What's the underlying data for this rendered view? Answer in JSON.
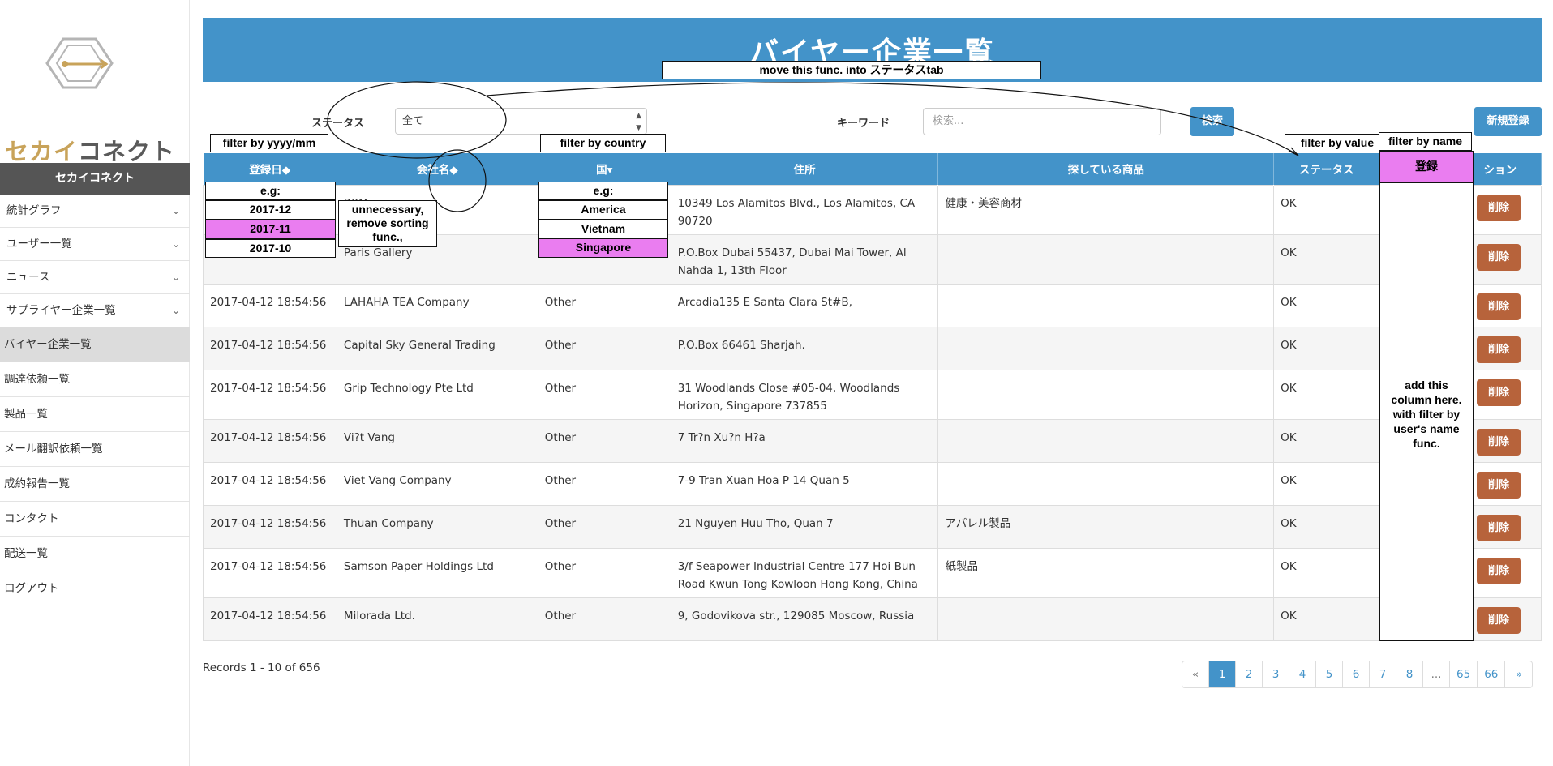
{
  "sidebar": {
    "logo_text_a": "セカイ",
    "logo_text_b": "コネクト",
    "header": "セカイコネクト",
    "items": [
      {
        "label": "統計グラフ",
        "chevron": "chevron-down-icon"
      },
      {
        "label": "ユーザー一覧",
        "chevron": "chevron-down-icon"
      },
      {
        "label": "ニュース",
        "chevron": "chevron-down-icon"
      },
      {
        "label": "サプライヤー企業一覧",
        "chevron": "chevron-down-icon"
      },
      {
        "label": "バイヤー企業一覧",
        "active": true
      },
      {
        "label": "調達依頼一覧"
      },
      {
        "label": "製品一覧"
      },
      {
        "label": "メール翻訳依頼一覧"
      },
      {
        "label": "成約報告一覧"
      },
      {
        "label": "コンタクト"
      },
      {
        "label": "配送一覧"
      },
      {
        "label": "ログアウト"
      }
    ]
  },
  "page": {
    "title": "バイヤー企業一覧"
  },
  "filters": {
    "status_label": "ステータス",
    "status_value": "全て",
    "keyword_label": "キーワード",
    "keyword_placeholder": "検索...",
    "search_button": "検索",
    "new_button": "新規登録"
  },
  "table": {
    "headers": [
      "登録日",
      "会社名",
      "国",
      "住所",
      "探している商品",
      "ステータス",
      "アクション"
    ],
    "header_display": {
      "date": "登録日◆",
      "company": "会社名◆",
      "country": "国▾",
      "address": "住所",
      "products": "探している商品",
      "status": "ステータス",
      "action": "ション"
    },
    "rows": [
      {
        "date": "",
        "company": "RKM",
        "country": "",
        "address": "10349 Los Alamitos Blvd., Los Alamitos, CA 90720",
        "products": "健康・美容商材",
        "status": "OK",
        "action": "削除"
      },
      {
        "date": "",
        "company": "Paris Gallery",
        "country": "",
        "address": "P.O.Box Dubai 55437, Dubai Mai Tower, Al Nahda 1, 13th Floor",
        "products": "",
        "status": "OK",
        "action": "削除"
      },
      {
        "date": "2017-04-12 18:54:56",
        "company": "LAHAHA TEA Company",
        "country": "Other",
        "address": "Arcadia135 E Santa Clara St#B,",
        "products": "",
        "status": "OK",
        "action": "削除"
      },
      {
        "date": "2017-04-12 18:54:56",
        "company": "Capital Sky General Trading",
        "country": "Other",
        "address": "P.O.Box 66461 Sharjah.",
        "products": "",
        "status": "OK",
        "action": "削除"
      },
      {
        "date": "2017-04-12 18:54:56",
        "company": "Grip Technology Pte Ltd",
        "country": "Other",
        "address": "31 Woodlands Close #05-04, Woodlands Horizon, Singapore 737855",
        "products": "",
        "status": "OK",
        "action": "削除"
      },
      {
        "date": "2017-04-12 18:54:56",
        "company": "Vi?t Vang",
        "country": "Other",
        "address": "7 Tr?n Xu?n H?a",
        "products": "",
        "status": "OK",
        "action": "削除"
      },
      {
        "date": "2017-04-12 18:54:56",
        "company": "Viet Vang Company",
        "country": "Other",
        "address": "7-9 Tran Xuan Hoa P 14 Quan 5",
        "products": "",
        "status": "OK",
        "action": "削除"
      },
      {
        "date": "2017-04-12 18:54:56",
        "company": "Thuan Company",
        "country": "Other",
        "address": "21 Nguyen Huu Tho, Quan 7",
        "products": "アパレル製品",
        "status": "OK",
        "action": "削除"
      },
      {
        "date": "2017-04-12 18:54:56",
        "company": "Samson Paper Holdings Ltd",
        "country": "Other",
        "address": "3/f Seapower Industrial Centre 177 Hoi Bun Road Kwun Tong Kowloon Hong Kong, China",
        "products": "紙製品",
        "status": "OK",
        "action": "削除"
      },
      {
        "date": "2017-04-12 18:54:56",
        "company": "Milorada Ltd.",
        "country": "Other",
        "address": "9, Godovikova str., 129085 Moscow, Russia",
        "products": "",
        "status": "OK",
        "action": "削除"
      }
    ]
  },
  "footer": {
    "records": "Records 1 - 10 of 656",
    "pages": [
      "«",
      "1",
      "2",
      "3",
      "4",
      "5",
      "6",
      "7",
      "8",
      "...",
      "65",
      "66",
      "»"
    ]
  },
  "annotations": {
    "move_func": "move this func. into ステータスtab",
    "filter_date": "filter by yyyy/mm",
    "filter_country": "filter by country",
    "filter_value": "filter by value",
    "filter_name": "filter by name",
    "register": "登録",
    "date_options": [
      "e.g:",
      "2017-12",
      "2017-11",
      "2017-10"
    ],
    "country_options": [
      "e.g:",
      "America",
      "Vietnam",
      "Singapore"
    ],
    "unnecessary": "unnecessary, remove sorting func.,",
    "add_column": "add this column here. with filter by user's name func."
  }
}
